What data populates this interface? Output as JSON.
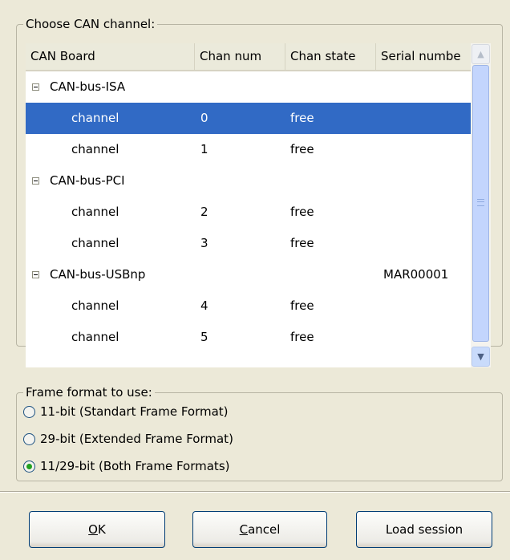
{
  "channel_group": {
    "title": "Choose CAN channel:"
  },
  "columns": [
    {
      "label": "CAN Board"
    },
    {
      "label": "Chan num"
    },
    {
      "label": "Chan state"
    },
    {
      "label": "Serial numbe"
    }
  ],
  "rows": [
    {
      "kind": "group",
      "board": "CAN-bus-ISA",
      "num": "",
      "state": "",
      "serial": "",
      "expanded": true
    },
    {
      "kind": "channel",
      "board": "channel",
      "num": "0",
      "state": "free",
      "serial": "",
      "selected": true
    },
    {
      "kind": "channel",
      "board": "channel",
      "num": "1",
      "state": "free",
      "serial": ""
    },
    {
      "kind": "group",
      "board": "CAN-bus-PCI",
      "num": "",
      "state": "",
      "serial": "",
      "expanded": true
    },
    {
      "kind": "channel",
      "board": "channel",
      "num": "2",
      "state": "free",
      "serial": ""
    },
    {
      "kind": "channel",
      "board": "channel",
      "num": "3",
      "state": "free",
      "serial": ""
    },
    {
      "kind": "group",
      "board": "CAN-bus-USBnp",
      "num": "",
      "state": "",
      "serial": "MAR00001",
      "expanded": true
    },
    {
      "kind": "channel",
      "board": "channel",
      "num": "4",
      "state": "free",
      "serial": ""
    },
    {
      "kind": "channel",
      "board": "channel",
      "num": "5",
      "state": "free",
      "serial": ""
    }
  ],
  "frame_group": {
    "title": "Frame format to use:",
    "options": [
      {
        "label": "11-bit (Standart Frame Format)",
        "checked": false
      },
      {
        "label": "29-bit (Extended Frame Format)",
        "checked": false
      },
      {
        "label": "11/29-bit (Both Frame Formats)",
        "checked": true
      }
    ]
  },
  "buttons": {
    "ok": {
      "mnemonic": "O",
      "rest": "K"
    },
    "cancel": {
      "mnemonic": "C",
      "rest": "ancel"
    },
    "load": {
      "label": "Load session"
    }
  },
  "colors": {
    "selection": "#316ac5",
    "window": "#ece9d8",
    "radio_dot": "#21a121"
  },
  "icons": {
    "expander": "minus-box-icon",
    "scroll_up": "chevron-up-icon",
    "scroll_down": "chevron-down-icon"
  }
}
